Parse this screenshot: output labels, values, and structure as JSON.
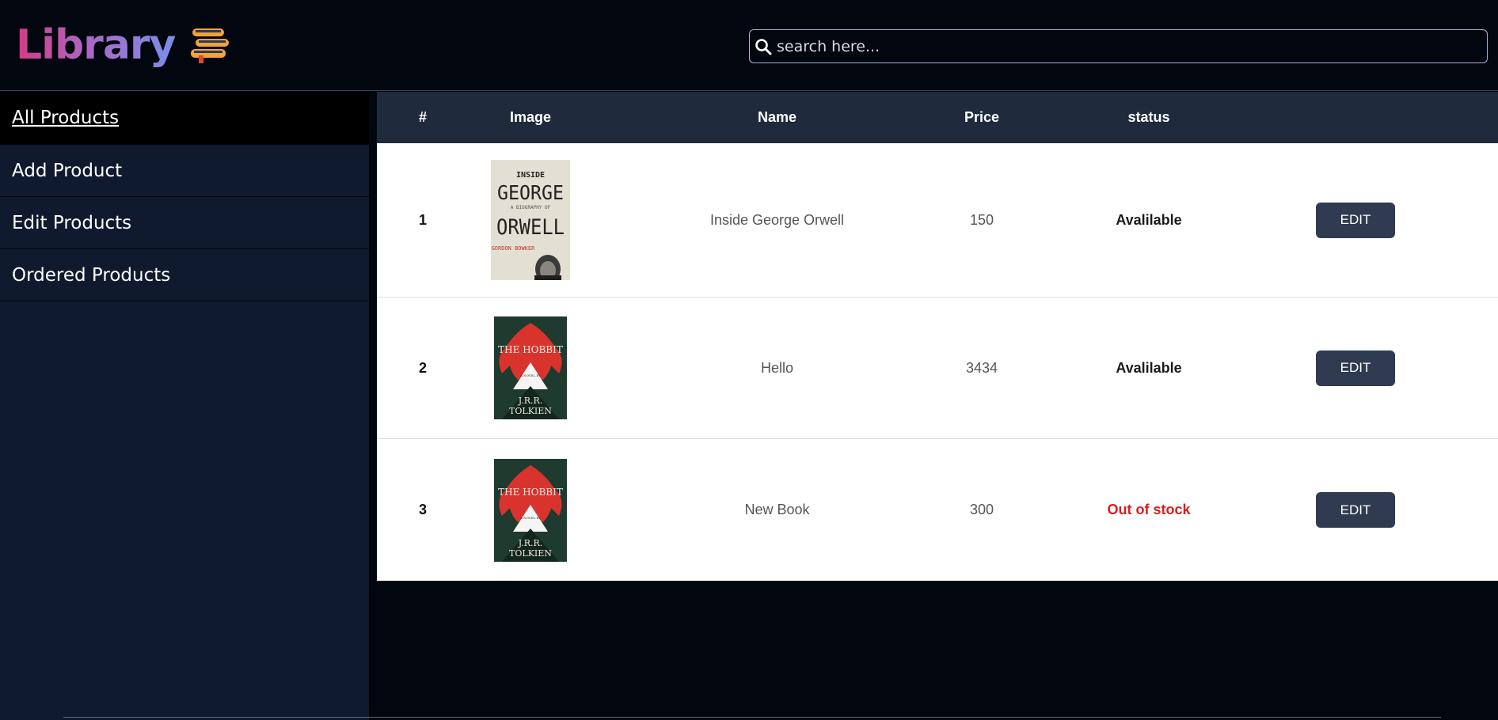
{
  "app": {
    "title": "Library"
  },
  "search": {
    "placeholder": "search here..."
  },
  "sidebar": {
    "items": [
      {
        "label": "All Products",
        "active": true
      },
      {
        "label": "Add Product"
      },
      {
        "label": "Edit Products"
      },
      {
        "label": "Ordered Products"
      }
    ]
  },
  "table": {
    "headers": [
      "#",
      "Image",
      "Name",
      "Price",
      "status",
      ""
    ],
    "rows": [
      {
        "num": "1",
        "image": "book-cover-inside-george-orwell",
        "name": "Inside George Orwell",
        "price": "150",
        "status": "Avalilable",
        "action": "EDIT"
      },
      {
        "num": "2",
        "image": "book-cover-the-hobbit",
        "name": "Hello",
        "price": "3434",
        "status": "Avalilable",
        "action": "EDIT"
      },
      {
        "num": "3",
        "image": "book-cover-the-hobbit",
        "name": "New Book",
        "price": "300",
        "status": "Out of stock",
        "action": "EDIT"
      }
    ]
  },
  "colors": {
    "background": "#02060f",
    "sidebar": "#101a2f",
    "table_header": "#1f2a3c",
    "button": "#2e3b50",
    "out_of_stock": "#e01b1b"
  },
  "covers": {
    "orwell": {
      "top": "INSIDE",
      "line1": "GEORGE",
      "sub": "A BIOGRAPHY OF",
      "line2": "ORWELL",
      "author": "GORDON BOWKER"
    },
    "hobbit": {
      "title": "THE HOBBIT",
      "sub": "A NOVEL BY",
      "author1": "J.R.R.",
      "author2": "TOLKIEN"
    }
  }
}
